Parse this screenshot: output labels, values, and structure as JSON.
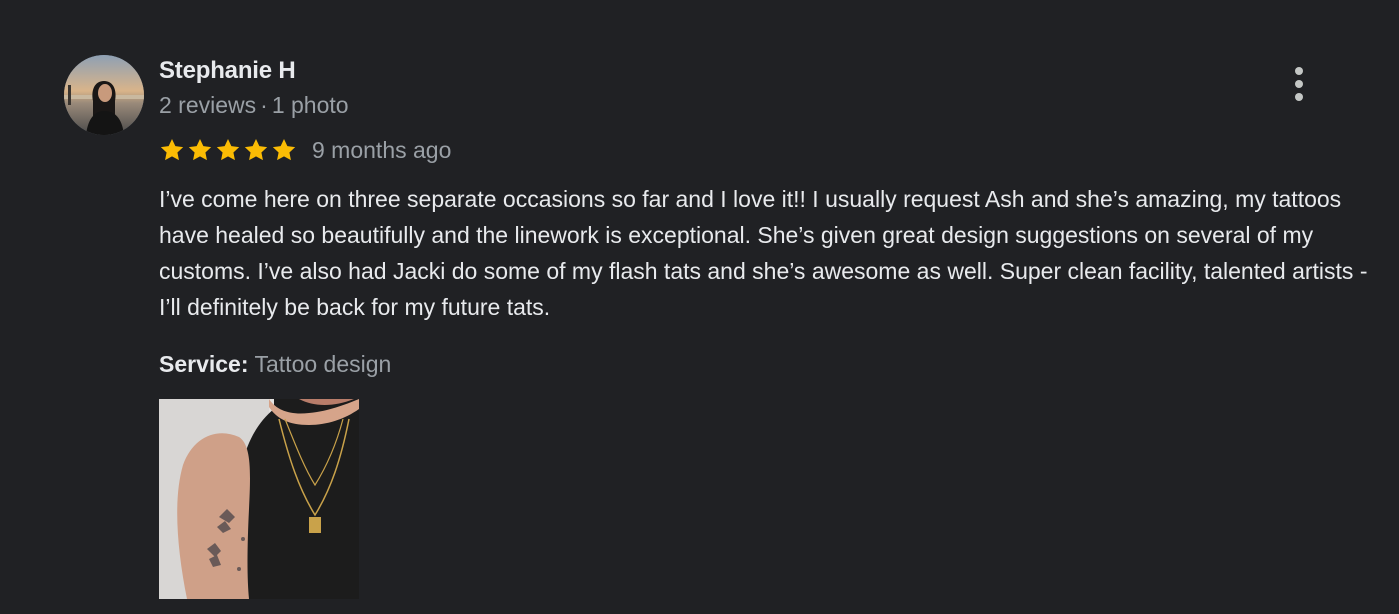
{
  "reviewer": {
    "name": "Stephanie H",
    "reviews_count": "2 reviews",
    "separator": "·",
    "photos_count": "1 photo"
  },
  "rating": {
    "stars": 5,
    "max_stars": 5,
    "star_color": "#fbbc04",
    "date": "9 months ago"
  },
  "review": {
    "text": "I’ve come here on three separate occasions so far and I love it!! I usually request Ash and she’s amazing, my tattoos have healed so beautifully and the linework is exceptional. She’s given great design suggestions on several of my customs. I’ve also had Jacki do some of my flash tats and she’s awesome as well. Super clean facility, talented artists - I’ll definitely be back for my future tats."
  },
  "service": {
    "label": "Service:",
    "value": "Tattoo design"
  },
  "icons": {
    "more": "more-vert-icon",
    "star": "star-icon"
  },
  "colors": {
    "background": "#202124",
    "primary_text": "#e8eaed",
    "secondary_text": "#9aa0a6"
  }
}
